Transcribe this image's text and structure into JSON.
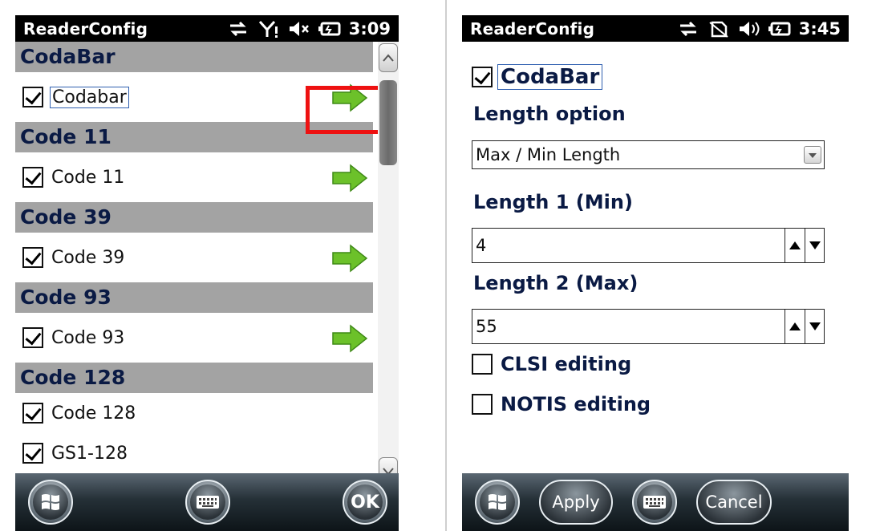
{
  "left": {
    "status": {
      "title": "ReaderConfig",
      "time": "3:09"
    },
    "groups": [
      {
        "header": "CodaBar",
        "items": [
          {
            "label": "Codabar",
            "checked": true,
            "arrow": true
          }
        ]
      },
      {
        "header": "Code 11",
        "items": [
          {
            "label": "Code 11",
            "checked": true,
            "arrow": true
          }
        ]
      },
      {
        "header": "Code 39",
        "items": [
          {
            "label": "Code 39",
            "checked": true,
            "arrow": true
          }
        ]
      },
      {
        "header": "Code 93",
        "items": [
          {
            "label": "Code 93",
            "checked": true,
            "arrow": true
          }
        ]
      },
      {
        "header": "Code 128",
        "items": [
          {
            "label": "Code 128",
            "checked": true,
            "arrow": false
          },
          {
            "label": "GS1-128",
            "checked": true,
            "arrow": false
          }
        ]
      }
    ],
    "bottom": {
      "ok_label": "OK"
    }
  },
  "right": {
    "status": {
      "title": "ReaderConfig",
      "time": "3:45"
    },
    "enable_label": "CodaBar",
    "length_option_label": "Length option",
    "length_option_value": "Max / Min Length",
    "length1_label": "Length 1 (Min)",
    "length1_value": "4",
    "length2_label": "Length 2 (Max)",
    "length2_value": "55",
    "clsi_label": "CLSI editing",
    "notis_label": "NOTIS editing",
    "bottom": {
      "apply_label": "Apply",
      "cancel_label": "Cancel"
    }
  },
  "colors": {
    "accent_highlight": "#ee1111",
    "group_header_bg": "#a3a3a3",
    "header_text": "#0a1a44",
    "arrow_green": "#6cc12a"
  }
}
